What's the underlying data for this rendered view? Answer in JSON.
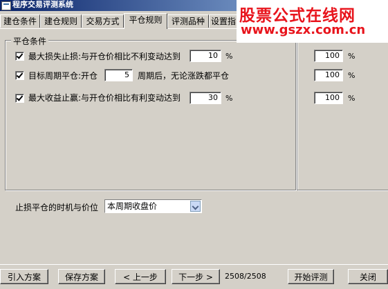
{
  "window": {
    "title": "程序交易评测系统"
  },
  "tabs": [
    "建仓条件",
    "建仓规则",
    "交易方式",
    "平仓规则",
    "评测品种",
    "设置指"
  ],
  "active_tab": "平仓规则",
  "group_left": {
    "title": "平仓条件",
    "rows": [
      {
        "label": "最大损失止损:与开仓价相比不利变动达到",
        "value": "10",
        "unit": "%"
      },
      {
        "label_a": "目标周期平仓:开仓",
        "value": "5",
        "label_b": "周期后，无论涨跌都平仓"
      },
      {
        "label": "最大收益止赢:与开仓价相比有利变动达到",
        "value": "30",
        "unit": "%"
      }
    ]
  },
  "group_right": {
    "values": [
      "100",
      "100",
      "100"
    ],
    "unit": "%"
  },
  "timing": {
    "label": "止损平仓的时机与价位",
    "selected": "本周期收盘价"
  },
  "footer": {
    "import": "引入方案",
    "save": "保存方案",
    "prev": "< 上一步",
    "next": "下一步 >",
    "counter": "2508/2508",
    "start": "开始评测",
    "close": "关闭"
  },
  "watermark": {
    "line1": "股票公式在线网",
    "line2": "www.gszx.com.cn"
  }
}
